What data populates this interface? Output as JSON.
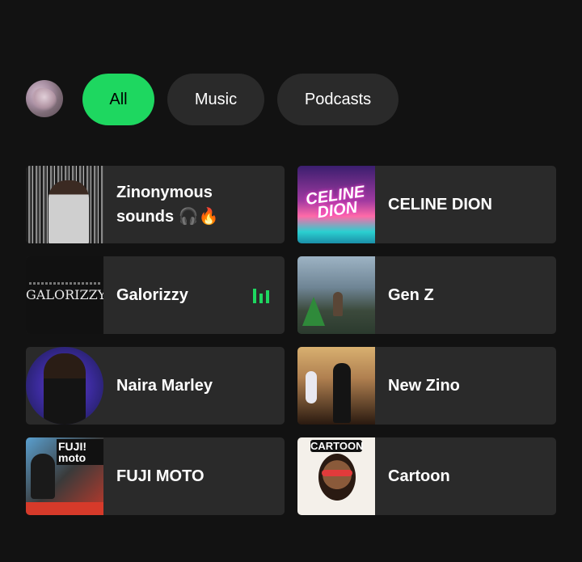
{
  "filters": {
    "all_label": "All",
    "music_label": "Music",
    "podcasts_label": "Podcasts",
    "active": "All"
  },
  "shortcuts": [
    {
      "title": "Zinonymous sounds",
      "emoji": "🎧🔥"
    },
    {
      "title": "CELINE DION"
    },
    {
      "title": "Galorizzy",
      "now_playing": true
    },
    {
      "title": "Gen Z"
    },
    {
      "title": "Naira Marley"
    },
    {
      "title": "New Zino"
    },
    {
      "title": "FUJI MOTO"
    },
    {
      "title": "Cartoon"
    }
  ],
  "artwork_text": {
    "celine": "CELINE DION",
    "galorizzy": "GALORIZZY",
    "fuji": "FUJI! moto",
    "cartoon": "CARTOON"
  },
  "colors": {
    "background": "#121212",
    "card": "#2a2a2a",
    "accent": "#1ed760"
  },
  "icons": {
    "now_playing": "equalizer-icon",
    "emoji": [
      "headphones",
      "fire"
    ]
  }
}
